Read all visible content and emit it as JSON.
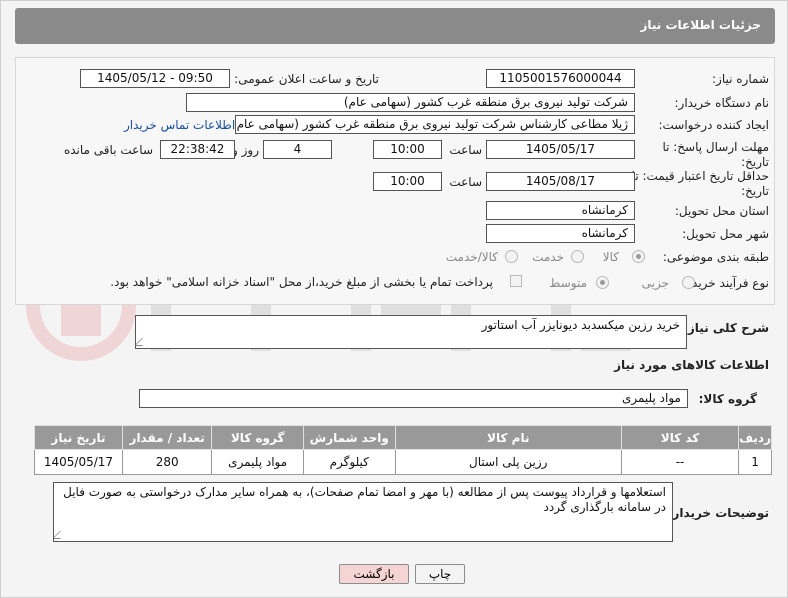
{
  "header": {
    "title": "جزئیات اطلاعات نیاز"
  },
  "form": {
    "need_number": {
      "label": "شماره نیاز:",
      "value": "1105001576000044"
    },
    "announce": {
      "label": "تاریخ و ساعت اعلان عمومی:",
      "value": "1405/05/12 - 09:50"
    },
    "buyer_org": {
      "label": "نام دستگاه خریدار:",
      "value": "شرکت تولید نیروی برق منطقه غرب کشور (سهامی عام)"
    },
    "creator": {
      "label": "ایجاد کننده درخواست:",
      "value": "ژیلا مطاعی کارشناس شرکت تولید نیروی برق منطقه غرب کشور (سهامی عام)",
      "contact_link": "اطلاعات تماس خریدار"
    },
    "reply_deadline": {
      "label": "مهلت ارسال پاسخ: تا تاریخ:",
      "date": "1405/05/17",
      "time_label": "ساعت",
      "time": "10:00",
      "days": "4",
      "days_label": "روز و",
      "remaining": "22:38:42",
      "remaining_label": "ساعت باقی مانده"
    },
    "price_validity": {
      "label": "حداقل تاریخ اعتبار قیمت: تا تاریخ:",
      "date": "1405/08/17",
      "time_label": "ساعت",
      "time": "10:00"
    },
    "province": {
      "label": "استان محل تحویل:",
      "value": "کرمانشاه"
    },
    "city": {
      "label": "شهر محل تحویل:",
      "value": "کرمانشاه"
    },
    "category": {
      "label": "طبقه بندی موضوعی:",
      "options": [
        "کالا",
        "خدمت",
        "کالا/خدمت"
      ],
      "selected": "کالا"
    },
    "purchase_type": {
      "label": "نوع فرآیند خرید :",
      "options": [
        "جزیی",
        "متوسط"
      ],
      "selected": "متوسط",
      "payment_note": "پرداخت تمام یا بخشی از مبلغ خرید،از محل \"اسناد خزانه اسلامی\" خواهد بود."
    }
  },
  "description": {
    "label": "شرح کلی نیاز:",
    "value": "خرید رزین میکسدبد دیونایزر آب استاتور"
  },
  "goods_section": {
    "title": "اطلاعات کالاهای مورد نیاز"
  },
  "goods_group": {
    "label": "گروه کالا:",
    "value": "مواد پلیمری"
  },
  "items_table": {
    "columns": [
      "ردیف",
      "کد کالا",
      "نام کالا",
      "واحد شمارش",
      "گروه کالا",
      "تعداد / مقدار",
      "تاریخ نیاز"
    ],
    "rows": [
      [
        "1",
        "--",
        "رزین پلی استال",
        "کیلوگرم",
        "مواد پلیمری",
        "280",
        "1405/05/17"
      ]
    ]
  },
  "buyer_notes": {
    "label": "توضیحات خریدار:",
    "value": "استعلامها و قرارداد پیوست پس از مطالعه (با مهر و امضا تمام صفحات)، به همراه سایر مدارک درخواستی به صورت فایل در سامانه بارگذاری گردد"
  },
  "buttons": {
    "print": "چاپ",
    "back": "بازگشت"
  },
  "colors": {
    "header_bg": "#8a8a8a",
    "table_head_bg": "#999999",
    "link": "#1a4fa0",
    "back_btn_bg": "#f5d4d4"
  }
}
